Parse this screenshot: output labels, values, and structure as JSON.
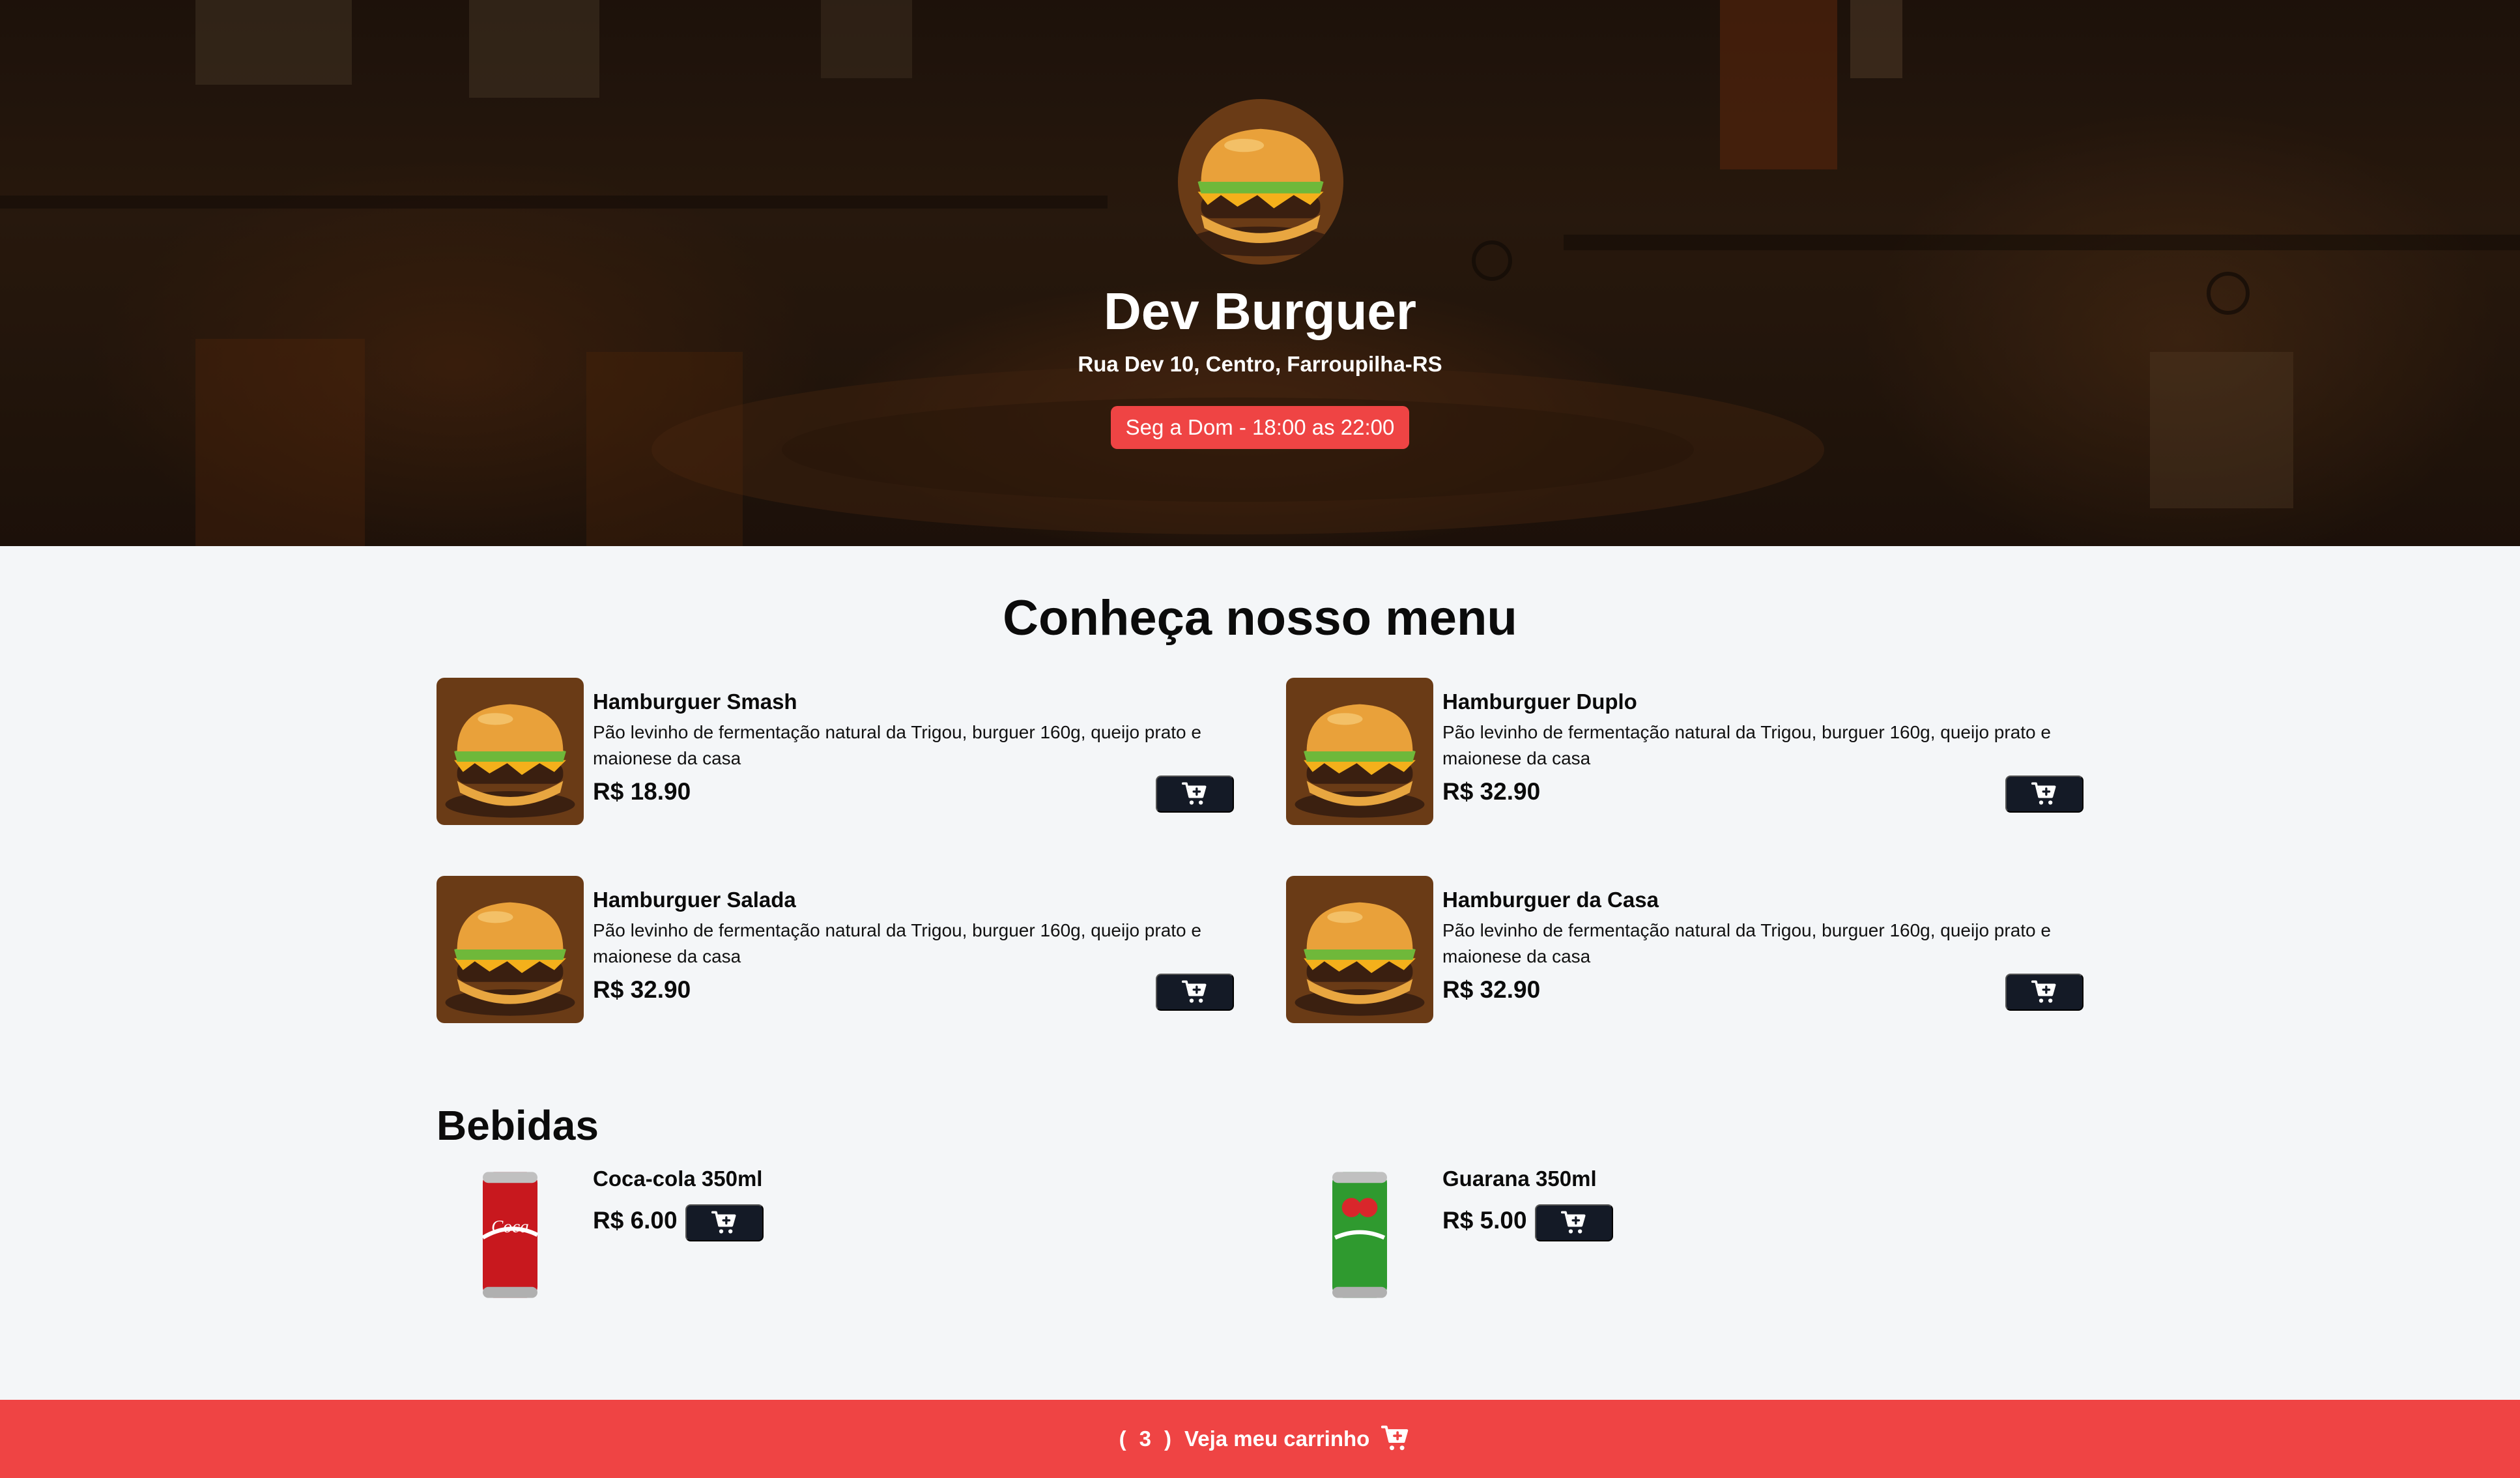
{
  "header": {
    "restaurant_name": "Dev Burguer",
    "address": "Rua Dev 10, Centro, Farroupilha-RS",
    "hours": "Seg a Dom - 18:00 as 22:00"
  },
  "menu": {
    "title": "Conheça nosso menu",
    "items": [
      {
        "name": "Hamburguer Smash",
        "description": "Pão levinho de fermentação natural da Trigou, burguer 160g, queijo prato e maionese da casa",
        "price": "R$ 18.90"
      },
      {
        "name": "Hamburguer Duplo",
        "description": "Pão levinho de fermentação natural da Trigou, burguer 160g, queijo prato e maionese da casa",
        "price": "R$ 32.90"
      },
      {
        "name": "Hamburguer Salada",
        "description": "Pão levinho de fermentação natural da Trigou, burguer 160g, queijo prato e maionese da casa",
        "price": "R$ 32.90"
      },
      {
        "name": "Hamburguer da Casa",
        "description": "Pão levinho de fermentação natural da Trigou, burguer 160g, queijo prato e maionese da casa",
        "price": "R$ 32.90"
      }
    ]
  },
  "drinks": {
    "title": "Bebidas",
    "items": [
      {
        "name": "Coca-cola 350ml",
        "price": "R$ 6.00"
      },
      {
        "name": "Guarana 350ml",
        "price": "R$ 5.00"
      }
    ]
  },
  "footer": {
    "open_paren": "(",
    "cart_count": "3",
    "close_paren": ")",
    "cart_label": "Veja meu carrinho"
  },
  "icons": {
    "cart": "cart-plus-icon",
    "cart_footer": "cart-icon"
  },
  "colors": {
    "accent": "#ef4444",
    "button_dark": "#141a26",
    "page_background": "#f4f6f8"
  }
}
